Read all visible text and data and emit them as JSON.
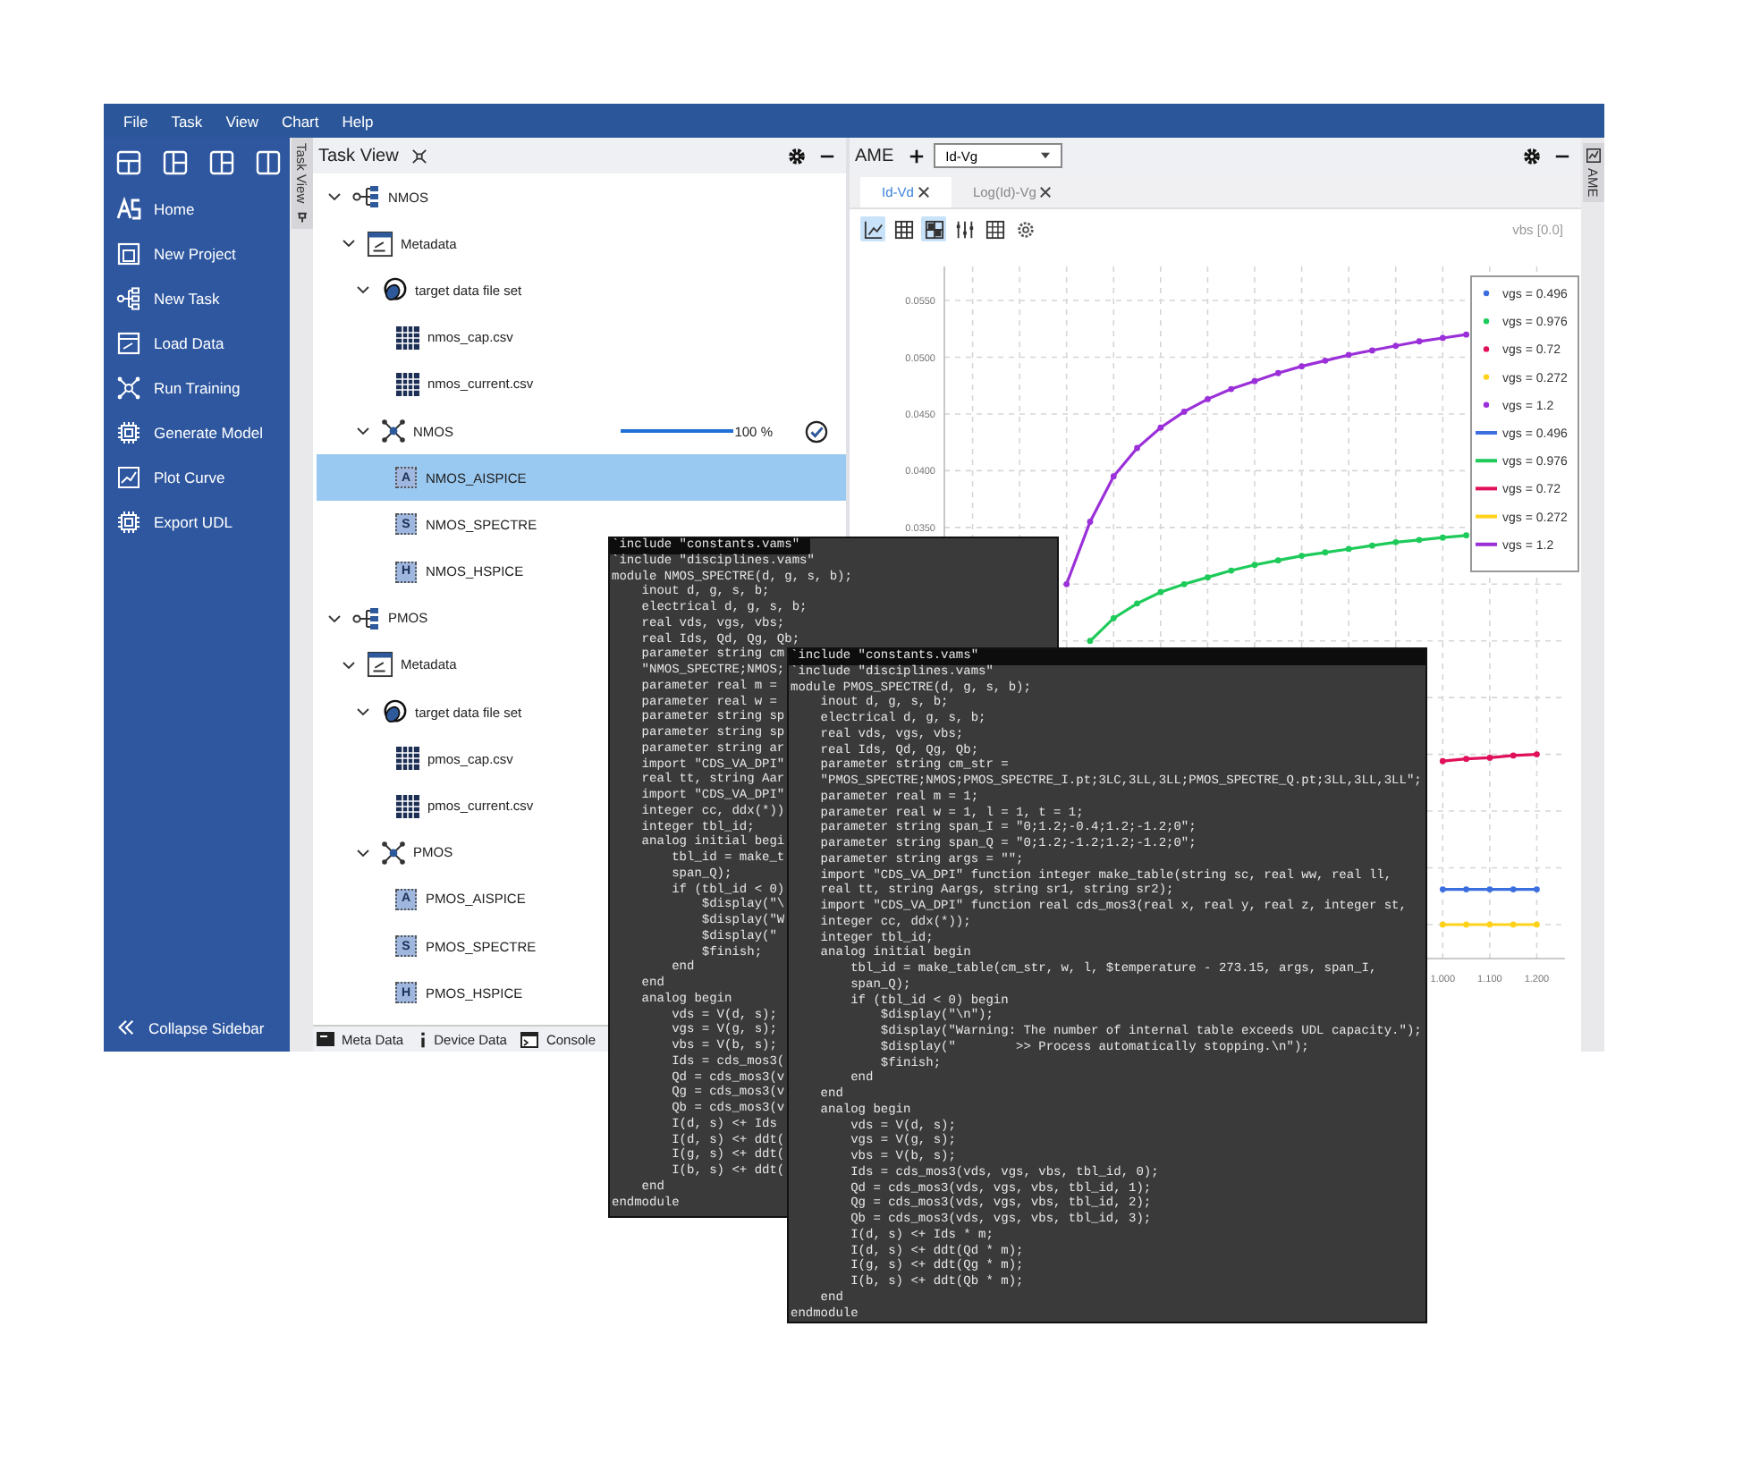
{
  "menu": [
    "File",
    "Task",
    "View",
    "Chart",
    "Help"
  ],
  "sidebar": {
    "items": [
      {
        "kind": "logo",
        "label": "Home"
      },
      {
        "kind": "document",
        "label": "New Project"
      },
      {
        "kind": "hierarchy",
        "label": "New Task"
      },
      {
        "kind": "form",
        "label": "Load Data"
      },
      {
        "kind": "network",
        "label": "Run Training"
      },
      {
        "kind": "chip",
        "label": "Generate Model"
      },
      {
        "kind": "chart",
        "label": "Plot Curve"
      },
      {
        "kind": "chip",
        "label": "Export UDL"
      }
    ],
    "collapse": "Collapse Sidebar"
  },
  "left_strip": {
    "label": "Task View"
  },
  "task_view": {
    "title": "Task View",
    "tree": [
      {
        "kind": "project",
        "label": "NMOS",
        "expanded": true,
        "selected": false,
        "children": [
          {
            "kind": "metadata",
            "label": "Metadata",
            "expanded": true,
            "selected": false,
            "children": [
              {
                "kind": "dataset",
                "label": "target data file set",
                "expanded": true,
                "selected": false,
                "children": [
                  {
                    "kind": "file",
                    "label": "nmos_cap.csv",
                    "selected": false
                  },
                  {
                    "kind": "file",
                    "label": "nmos_current.csv",
                    "selected": false
                  }
                ]
              },
              {
                "kind": "training",
                "label": "NMOS",
                "expanded": true,
                "selected": false,
                "level": 1,
                "reading": "100 %",
                "done": true,
                "children": [
                  {
                    "kind": "model",
                    "label": "NMOS_AISPICE",
                    "badge": "A",
                    "selected": true
                  },
                  {
                    "kind": "model",
                    "label": "NMOS_SPECTRE",
                    "badge": "S",
                    "selected": false
                  },
                  {
                    "kind": "model",
                    "label": "NMOS_HSPICE",
                    "badge": "H",
                    "selected": false
                  }
                ]
              }
            ]
          }
        ]
      },
      {
        "kind": "project",
        "label": "PMOS",
        "expanded": true,
        "selected": false,
        "children": [
          {
            "kind": "metadata",
            "label": "Metadata",
            "expanded": true,
            "selected": false,
            "children": [
              {
                "kind": "dataset",
                "label": "target data file set",
                "expanded": true,
                "selected": false,
                "children": [
                  {
                    "kind": "file",
                    "label": "pmos_cap.csv",
                    "selected": false
                  },
                  {
                    "kind": "file",
                    "label": "pmos_current.csv",
                    "selected": false
                  }
                ]
              },
              {
                "kind": "training",
                "label": "PMOS",
                "expanded": true,
                "selected": false,
                "children": [
                  {
                    "kind": "model",
                    "label": "PMOS_AISPICE",
                    "badge": "A",
                    "selected": false
                  },
                  {
                    "kind": "model",
                    "label": "PMOS_SPECTRE",
                    "badge": "S",
                    "selected": false
                  },
                  {
                    "kind": "model",
                    "label": "PMOS_HSPICE",
                    "badge": "H",
                    "selected": false
                  }
                ]
              }
            ]
          }
        ]
      }
    ],
    "bottom_tabs": [
      {
        "kind": "card",
        "label": "Meta Data"
      },
      {
        "kind": "info",
        "label": "Device Data"
      },
      {
        "kind": "terminal",
        "label": "Console"
      }
    ]
  },
  "chart_panel": {
    "title": "AME",
    "dropdown": "Id-Vg",
    "tabs": [
      {
        "label": "Id-Vd",
        "selected": true
      },
      {
        "label": "Log(Id)-Vg",
        "selected": false
      }
    ],
    "toolbar": [
      {
        "kind": "axes",
        "on": true
      },
      {
        "kind": "grid",
        "on": false
      },
      {
        "kind": "tiles",
        "on": true
      },
      {
        "kind": "sliders",
        "on": false
      },
      {
        "kind": "table",
        "on": false
      },
      {
        "kind": "settings",
        "on": false
      }
    ],
    "condition": "vbs [0.0]",
    "chart_data": {
      "type": "line",
      "grid": true,
      "legend": "upper right",
      "x": [
        0.2,
        0.25,
        0.3,
        0.35,
        0.4,
        0.45,
        0.5,
        0.55,
        0.6,
        0.65,
        0.7,
        0.75,
        0.8,
        0.85,
        0.9,
        0.95,
        1,
        1.05,
        1.1,
        1.15,
        1.2
      ],
      "xlim": [
        -0.06,
        1.26
      ],
      "ylim": [
        -0.003,
        0.058
      ],
      "xticks": [
        {
          "value": 1,
          "label": "1.000"
        },
        {
          "value": 1.1,
          "label": "1.100"
        },
        {
          "value": 1.2,
          "label": "1.200"
        }
      ],
      "yticks": [
        {
          "value": 0.035,
          "label": "0.0350"
        },
        {
          "value": 0.04,
          "label": "0.0400"
        },
        {
          "value": 0.045,
          "label": "0.0450"
        },
        {
          "value": 0.05,
          "label": "0.0500"
        },
        {
          "value": 0.055,
          "label": "0.0550"
        }
      ],
      "series": [
        {
          "name": "vgs = 0.496",
          "color": "#3b6fe0",
          "marker": "circle",
          "values": [
            null,
            null,
            null,
            null,
            null,
            null,
            null,
            null,
            null,
            null,
            null,
            null,
            null,
            null,
            null,
            null,
            0.0031,
            0.0031,
            0.0031,
            0.0031,
            0.0031
          ]
        },
        {
          "name": "vgs = 0.976",
          "color": "#1ecb5a",
          "marker": "circle",
          "values": [
            null,
            0.025,
            0.027,
            0.0283,
            0.0293,
            0.03,
            0.0306,
            0.0312,
            0.0317,
            0.0321,
            0.0325,
            0.0328,
            0.0331,
            0.0334,
            0.0337,
            0.0339,
            0.0341,
            0.0343,
            null,
            null,
            null
          ]
        },
        {
          "name": "vgs = 0.72",
          "color": "#e0105a",
          "marker": "circle",
          "values": [
            null,
            null,
            null,
            null,
            null,
            null,
            null,
            null,
            null,
            null,
            null,
            null,
            null,
            null,
            null,
            null,
            0.0144,
            0.0146,
            0.0147,
            0.0149,
            0.015
          ]
        },
        {
          "name": "vgs = 0.272",
          "color": "#ffd21a",
          "marker": "circle",
          "values": [
            null,
            null,
            null,
            null,
            null,
            null,
            null,
            null,
            null,
            null,
            null,
            null,
            null,
            null,
            null,
            null,
            0,
            0,
            0,
            0,
            0
          ]
        },
        {
          "name": "vgs = 1.2",
          "color": "#9b30d9",
          "marker": "circle",
          "values": [
            0.03,
            0.0355,
            0.0395,
            0.042,
            0.0438,
            0.0452,
            0.0463,
            0.0472,
            0.0479,
            0.0486,
            0.0492,
            0.0497,
            0.0502,
            0.0506,
            0.051,
            0.0514,
            0.0517,
            0.052,
            null,
            null,
            null
          ]
        }
      ]
    }
  },
  "right_strip": {
    "label": "AME"
  },
  "code_windows": [
    {
      "lines": [
        "`include \"constants.vams\"",
        "`include \"disciplines.vams\"",
        "module NMOS_SPECTRE(d, g, s, b);",
        "    inout d, g, s, b;",
        "    electrical d, g, s, b;",
        "    real vds, vgs, vbs;",
        "    real Ids, Qd, Qg, Qb;",
        "    parameter string cm",
        "    \"NMOS_SPECTRE;NMOS;",
        "    parameter real m =",
        "    parameter real w =",
        "    parameter string sp",
        "    parameter string sp",
        "    parameter string ar",
        "    import \"CDS_VA_DPI\"",
        "    real tt, string Aar",
        "    import \"CDS_VA_DPI\"",
        "    integer cc, ddx(*))",
        "    integer tbl_id;",
        "    analog initial begi",
        "        tbl_id = make_t",
        "        span_Q);",
        "        if (tbl_id < 0)",
        "            $display(\"\\",
        "            $display(\"W",
        "            $display(\"",
        "            $finish;",
        "        end",
        "    end",
        "    analog begin",
        "        vds = V(d, s);",
        "        vgs = V(g, s);",
        "        vbs = V(b, s);",
        "        Ids = cds_mos3(",
        "        Qd = cds_mos3(v",
        "        Qg = cds_mos3(v",
        "        Qb = cds_mos3(v",
        "        I(d, s) <+ Ids",
        "        I(d, s) <+ ddt(",
        "        I(g, s) <+ ddt(",
        "        I(b, s) <+ ddt(",
        "    end",
        "endmodule"
      ]
    },
    {
      "lines": [
        "`include \"constants.vams\"",
        "`include \"disciplines.vams\"",
        "module PMOS_SPECTRE(d, g, s, b);",
        "    inout d, g, s, b;",
        "    electrical d, g, s, b;",
        "    real vds, vgs, vbs;",
        "    real Ids, Qd, Qg, Qb;",
        "    parameter string cm_str =",
        "    \"PMOS_SPECTRE;NMOS;PMOS_SPECTRE_I.pt;3LC,3LL,3LL;PMOS_SPECTRE_Q.pt;3LL,3LL,3LL\";",
        "    parameter real m = 1;",
        "    parameter real w = 1, l = 1, t = 1;",
        "    parameter string span_I = \"0;1.2;-0.4;1.2;-1.2;0\";",
        "    parameter string span_Q = \"0;1.2;-1.2;1.2;-1.2;0\";",
        "    parameter string args = \"\";",
        "    import \"CDS_VA_DPI\" function integer make_table(string sc, real ww, real ll,",
        "    real tt, string Aargs, string sr1, string sr2);",
        "    import \"CDS_VA_DPI\" function real cds_mos3(real x, real y, real z, integer st,",
        "    integer cc, ddx(*));",
        "    integer tbl_id;",
        "    analog initial begin",
        "        tbl_id = make_table(cm_str, w, l, $temperature - 273.15, args, span_I,",
        "        span_Q);",
        "        if (tbl_id < 0) begin",
        "            $display(\"\\n\");",
        "            $display(\"Warning: The number of internal table exceeds UDL capacity.\");",
        "            $display(\"        >> Process automatically stopping.\\n\");",
        "            $finish;",
        "        end",
        "    end",
        "    analog begin",
        "        vds = V(d, s);",
        "        vgs = V(g, s);",
        "        vbs = V(b, s);",
        "        Ids = cds_mos3(vds, vgs, vbs, tbl_id, 0);",
        "        Qd = cds_mos3(vds, vgs, vbs, tbl_id, 1);",
        "        Qg = cds_mos3(vds, vgs, vbs, tbl_id, 2);",
        "        Qb = cds_mos3(vds, vgs, vbs, tbl_id, 3);",
        "        I(d, s) <+ Ids * m;",
        "        I(d, s) <+ ddt(Qd * m);",
        "        I(g, s) <+ ddt(Qg * m);",
        "        I(b, s) <+ ddt(Qb * m);",
        "    end",
        "endmodule"
      ]
    }
  ]
}
